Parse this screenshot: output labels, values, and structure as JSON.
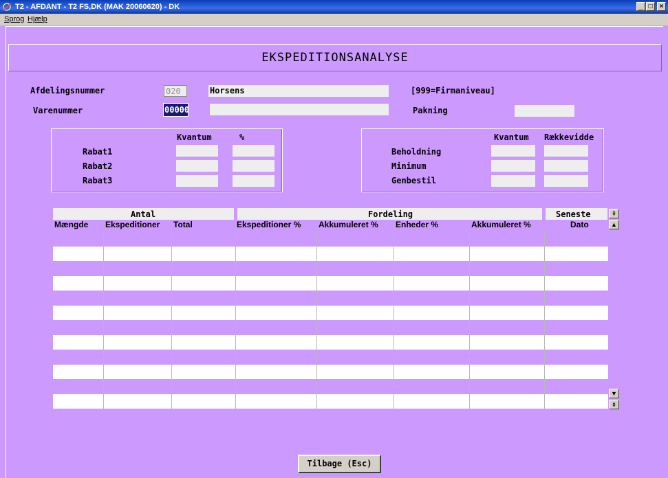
{
  "window": {
    "title": "T2 - AFDANT - T2 FS,DK (MAK 20060620) - DK",
    "btn_min": "_",
    "btn_max": "□",
    "btn_close": "×"
  },
  "menu": {
    "items": [
      "Sprog",
      "Hjælp"
    ]
  },
  "screen_title": "EKSPEDITIONSANALYSE",
  "form": {
    "afdeling_label": "Afdelingsnummer",
    "afdeling_value": "020",
    "afdeling_name": "Horsens",
    "afdeling_hint": "[999=Firmaniveau]",
    "varenummer_label": "Varenummer",
    "varenummer_value": "00000",
    "varenummer_desc": "",
    "pakning_label": "Pakning",
    "pakning_value": ""
  },
  "rabat": {
    "col_kvantum": "Kvantum",
    "col_pct": "%",
    "rows": [
      "Rabat1",
      "Rabat2",
      "Rabat3"
    ]
  },
  "beholdning": {
    "col_kvantum": "Kvantum",
    "col_raekkevidde": "Rækkevidde",
    "rows": [
      "Beholdning",
      "Minimum",
      "Genbestil"
    ]
  },
  "table": {
    "group_antal": "Antal",
    "group_fordeling": "Fordeling",
    "group_seneste": "Seneste",
    "columns": [
      "Mængde",
      "Ekspeditioner",
      "Total",
      "Ekspeditioner %",
      "Akkumuleret %",
      "Enheder %",
      "Akkumuleret %",
      "Dato"
    ]
  },
  "scroll": {
    "top": "⇞",
    "up": "▲",
    "down": "▼",
    "bottom": "⇟"
  },
  "buttons": {
    "back": "Tilbage (Esc)"
  },
  "colors": {
    "background": "#cc99ff",
    "field": "#eeeeee",
    "titlebar": "#0b3fb8"
  }
}
